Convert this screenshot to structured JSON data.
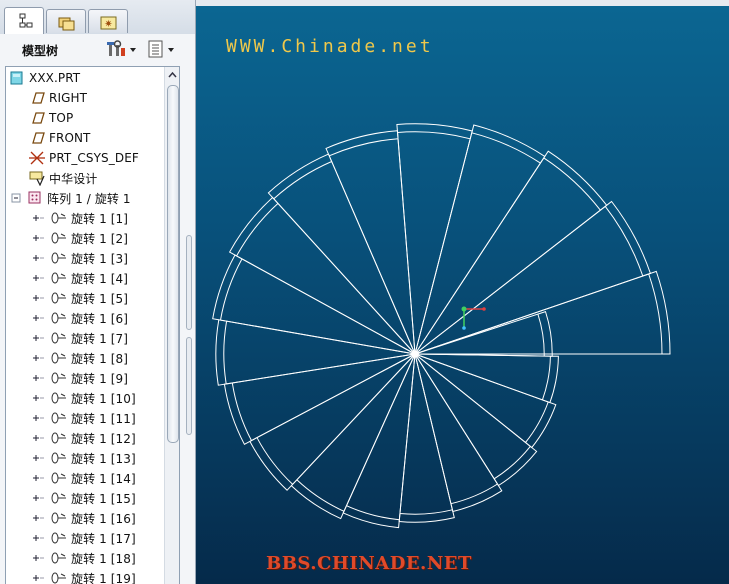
{
  "panel": {
    "tabs": [
      {
        "icon": "model-tree-icon"
      },
      {
        "icon": "folder-browser-icon"
      },
      {
        "icon": "favorites-icon"
      }
    ],
    "title": "模型树",
    "tools": [
      {
        "icon": "tree-settings-icon"
      },
      {
        "icon": "show-options-icon"
      }
    ]
  },
  "tree": {
    "root": "XXX.PRT",
    "items": [
      {
        "label": "RIGHT",
        "icon": "datum-plane-icon"
      },
      {
        "label": "TOP",
        "icon": "datum-plane-icon"
      },
      {
        "label": "FRONT",
        "icon": "datum-plane-icon"
      },
      {
        "label": "PRT_CSYS_DEF",
        "icon": "csys-icon"
      },
      {
        "label": "中华设计",
        "icon": "sketch-icon"
      }
    ],
    "pattern": {
      "label": "阵列 1 / 旋转 1",
      "icon": "pattern-icon"
    },
    "children": [
      "旋转 1 [1]",
      "旋转 1 [2]",
      "旋转 1 [3]",
      "旋转 1 [4]",
      "旋转 1 [5]",
      "旋转 1 [6]",
      "旋转 1 [7]",
      "旋转 1 [8]",
      "旋转 1 [9]",
      "旋转 1 [10]",
      "旋转 1 [11]",
      "旋转 1 [12]",
      "旋转 1 [13]",
      "旋转 1 [14]",
      "旋转 1 [15]",
      "旋转 1 [16]",
      "旋转 1 [17]",
      "旋转 1 [18]",
      "旋转 1 [19]"
    ]
  },
  "viewport": {
    "watermark_top": "WWW.Chinade.net",
    "watermark_bottom": "BBS.CHINADE.NET",
    "colors": {
      "bg_top": "#0b6692",
      "bg_bottom": "#052a4a",
      "edges": "#ffffff",
      "wm_top": "#f0c84a",
      "wm_bottom": "#e04a2a"
    }
  }
}
